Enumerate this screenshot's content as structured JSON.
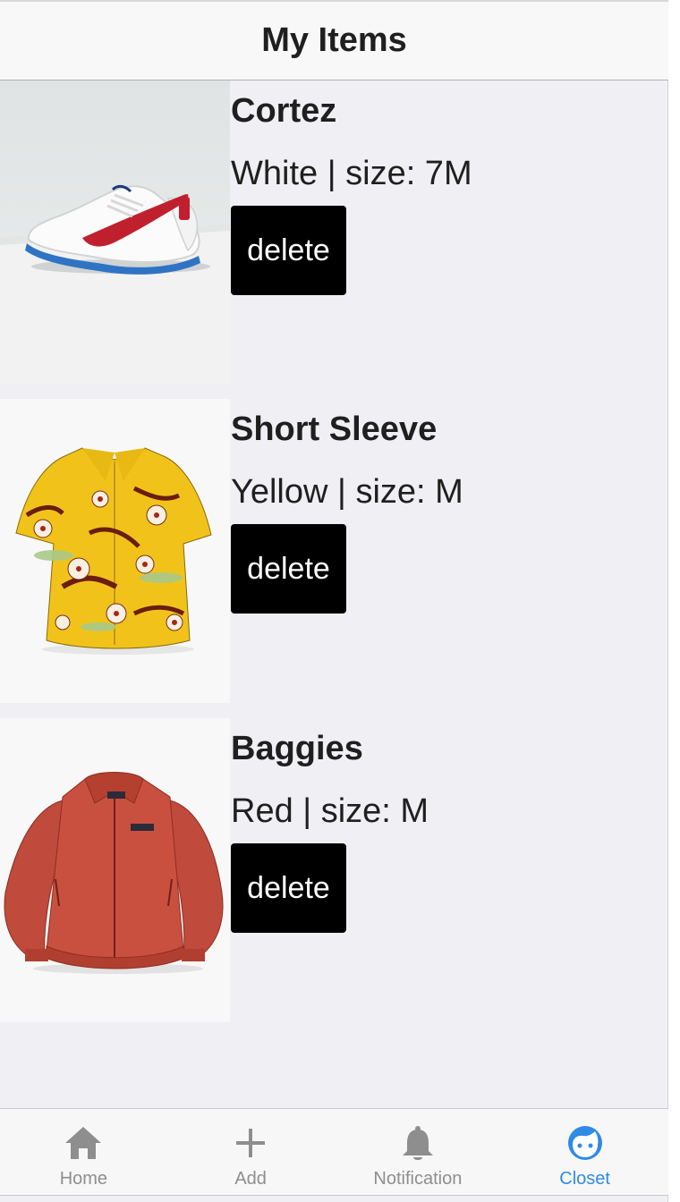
{
  "header": {
    "title": "My Items"
  },
  "items": [
    {
      "name": "Cortez",
      "desc": "White | size: 7M",
      "delete_label": "delete"
    },
    {
      "name": "Short Sleeve",
      "desc": "Yellow | size: M",
      "delete_label": "delete"
    },
    {
      "name": "Baggies",
      "desc": "Red | size: M",
      "delete_label": "delete"
    }
  ],
  "tabbar": {
    "tabs": [
      {
        "label": "Home",
        "icon": "home-icon"
      },
      {
        "label": "Add",
        "icon": "plus-icon"
      },
      {
        "label": "Notification",
        "icon": "bell-icon"
      },
      {
        "label": "Closet",
        "icon": "face-icon"
      }
    ],
    "active": "Closet",
    "inactive_color": "#8e8e8e",
    "active_color": "#2f8be6"
  }
}
